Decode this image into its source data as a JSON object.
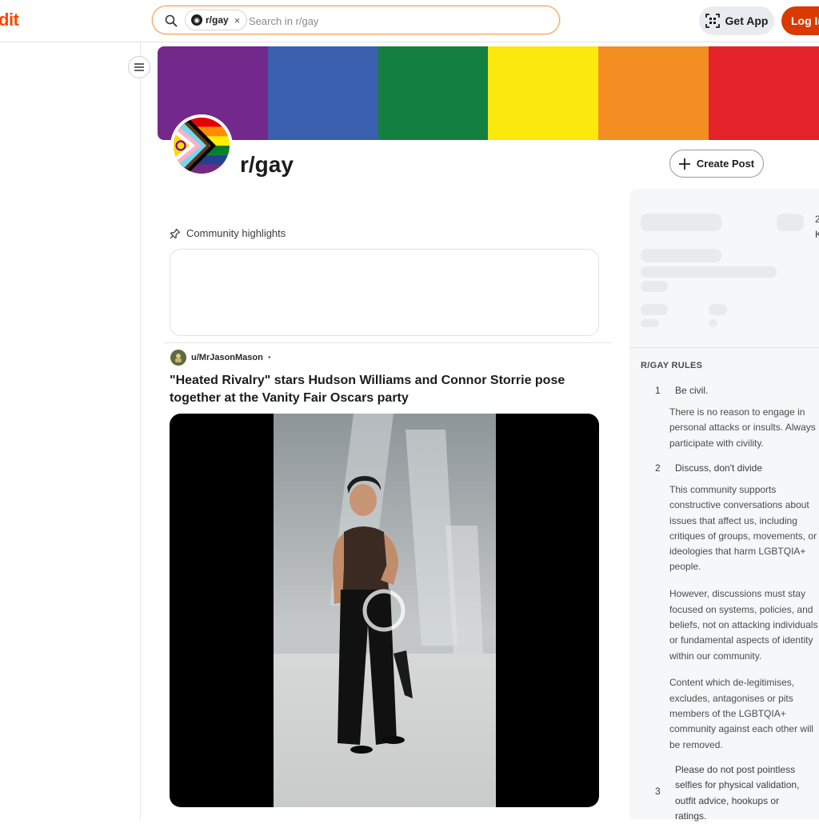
{
  "header": {
    "logo_fragment": "dit",
    "search_chip_label": "r/gay",
    "search_chip_close": "×",
    "search_placeholder": "Search in r/gay",
    "get_app_label": "Get App",
    "login_label": "Log In"
  },
  "subreddit": {
    "name": "r/gay",
    "create_post_label": "Create Post",
    "banner_colors": [
      "#73298b",
      "#3a5fae",
      "#14803f",
      "#fbe80d",
      "#f48e22",
      "#e3222a"
    ]
  },
  "highlights": {
    "title": "Community highlights"
  },
  "post": {
    "author": "u/MrJasonMason",
    "separator": "•",
    "title": "\"Heated Rivalry\" stars Hudson Williams and Connor Storrie pose together at the Vanity Fair Oscars party"
  },
  "sidebar": {
    "stat_fragments": [
      "2",
      "K"
    ],
    "rules_title": "R/GAY RULES",
    "rules": [
      {
        "number": "1",
        "title": "Be civil.",
        "lines": [
          "There is no reason to engage in",
          "personal attacks or insults. Always",
          "participate with civility."
        ]
      },
      {
        "number": "2",
        "title": "Discuss, don't divide",
        "lines": [
          "This community supports",
          "constructive conversations about",
          "issues that affect us, including",
          "critiques of groups, movements, or",
          "ideologies that harm LGBTQIA+",
          "people.",
          "",
          "However, discussions must stay",
          "focused on systems, policies, and",
          "beliefs, not on attacking individuals",
          "or fundamental aspects of identity",
          "within our community.",
          "",
          "Content which de-legitimises,",
          "excludes, antagonises or pits",
          "members of the LGBTQIA+",
          "community against each other will",
          "be removed."
        ]
      },
      {
        "number": "3",
        "title_lines": [
          "Please do not post pointless",
          "selfies for physical validation,",
          "outfit advice, hookups or",
          "ratings."
        ]
      }
    ]
  },
  "icons": {
    "search": "search-icon",
    "qr": "qr-code-icon",
    "menu": "hamburger-menu-icon",
    "plus": "plus-icon",
    "pin": "pin-icon",
    "close": "close-icon",
    "loading": "loading-spinner-icon"
  }
}
